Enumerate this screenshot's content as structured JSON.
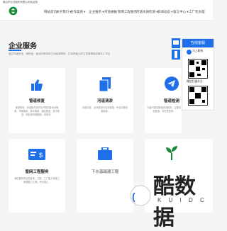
{
  "topbar": {
    "text": "佛山市业社股份有限公司欢迎您"
  },
  "nav": {
    "items": [
      {
        "label": "网站首页"
      },
      {
        "label": "关于我们 ▾"
      },
      {
        "label": "合作案例 ▾"
      },
      {
        "label": "企业服务 ▾"
      },
      {
        "label": "河道通报"
      },
      {
        "label": "管网工程服务"
      },
      {
        "label": "河道水质检测 ▾"
      },
      {
        "label": "新闻动态 ▾"
      },
      {
        "label": "留言中心 ▾"
      },
      {
        "label": "工厂在办理"
      }
    ]
  },
  "hero": {
    "title": "企业服务",
    "subtitle": "通过沟通来来、满怀信、面对的需求的力对客观需求，打造再最大的注意管理接收服务工作区"
  },
  "cards": [
    {
      "title": "管道修复",
      "desc": "管道修复、采用极先进的非开挖的技术对管道、市政管网、排水管网、通信管道、进行修复，修复的时期缩短、成本低..."
    },
    {
      "title": "河道清淤",
      "desc": "河道清淤、对河道进行清淤处理，专业清理河道疏通..."
    },
    {
      "title": "管道检测",
      "desc": "为客户提供管道检测服务，主要包括管道、非开挖检测..."
    },
    {
      "title": "管网工程服务",
      "desc": "我们都有专业的技术、工程、工厂能力和施工管理能力工程，专业施工..."
    },
    {
      "title": "下水道疏通工程",
      "desc": ""
    },
    {
      "title": "",
      "desc": ""
    }
  ],
  "popup": {
    "header": "在线客服",
    "label1": "马上联系",
    "label2": "微信扫描关注"
  },
  "watermark": {
    "brand": "酷数据",
    "sub": "K U I D C"
  },
  "colors": {
    "accent": "#1f6feb",
    "icon": "#1f6feb"
  }
}
